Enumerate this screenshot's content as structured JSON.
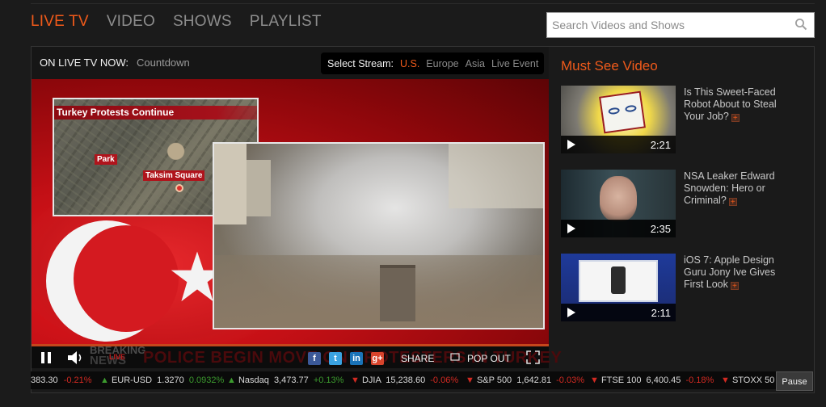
{
  "nav": {
    "tabs": [
      {
        "label": "LIVE TV",
        "active": true
      },
      {
        "label": "VIDEO",
        "active": false
      },
      {
        "label": "SHOWS",
        "active": false
      },
      {
        "label": "PLAYLIST",
        "active": false
      }
    ]
  },
  "search": {
    "placeholder": "Search Videos and Shows",
    "icon": "search-icon"
  },
  "player": {
    "on_live_label": "ON LIVE TV NOW:",
    "on_live_value": "Countdown",
    "stream": {
      "label": "Select Stream:",
      "options": [
        "U.S.",
        "Europe",
        "Asia",
        "Live Event"
      ],
      "selected": "U.S."
    },
    "map": {
      "title": "Turkey Protests Continue",
      "labels": [
        "Park",
        "Taksim Square"
      ]
    },
    "lower_third": {
      "breaking": "BREAKING",
      "news": "NEWS",
      "live": "LIVE",
      "headline": "POLICE BEGIN MOVE ON PROTESTERS IN TURKEY"
    },
    "controls": {
      "pause_icon": "pause-icon",
      "volume_icon": "volume-icon",
      "share_label": "SHARE",
      "popout_label": "POP OUT",
      "fullscreen_icon": "fullscreen-icon",
      "social": [
        "f",
        "t",
        "in",
        "g+"
      ]
    }
  },
  "sidebar": {
    "title": "Must See Video",
    "videos": [
      {
        "title": "Is This Sweet-Faced Robot About to Steal Your Job?",
        "duration": "2:21"
      },
      {
        "title": "NSA Leaker Edward Snowden: Hero or Criminal?",
        "duration": "2:35"
      },
      {
        "title": "iOS 7: Apple Design Guru Jony Ive Gives First Look",
        "duration": "2:11"
      }
    ]
  },
  "ticker": {
    "items": [
      {
        "name": "",
        "value": "383.30",
        "change": "-0.21%",
        "dir": "down"
      },
      {
        "name": "EUR-USD",
        "value": "1.3270",
        "change": "0.0932%",
        "dir": "up"
      },
      {
        "name": "Nasdaq",
        "value": "3,473.77",
        "change": "+0.13%",
        "dir": "up"
      },
      {
        "name": "DJIA",
        "value": "15,238.60",
        "change": "-0.06%",
        "dir": "down"
      },
      {
        "name": "S&P 500",
        "value": "1,642.81",
        "change": "-0.03%",
        "dir": "down"
      },
      {
        "name": "FTSE 100",
        "value": "6,400.45",
        "change": "-0.18%",
        "dir": "down"
      },
      {
        "name": "STOXX 50",
        "value": "",
        "change": "",
        "dir": "down"
      }
    ],
    "pause_label": "Pause"
  },
  "colors": {
    "accent": "#f05a1a",
    "up": "#3c9a2e",
    "down": "#d22a22",
    "background": "#1b1b1b"
  }
}
